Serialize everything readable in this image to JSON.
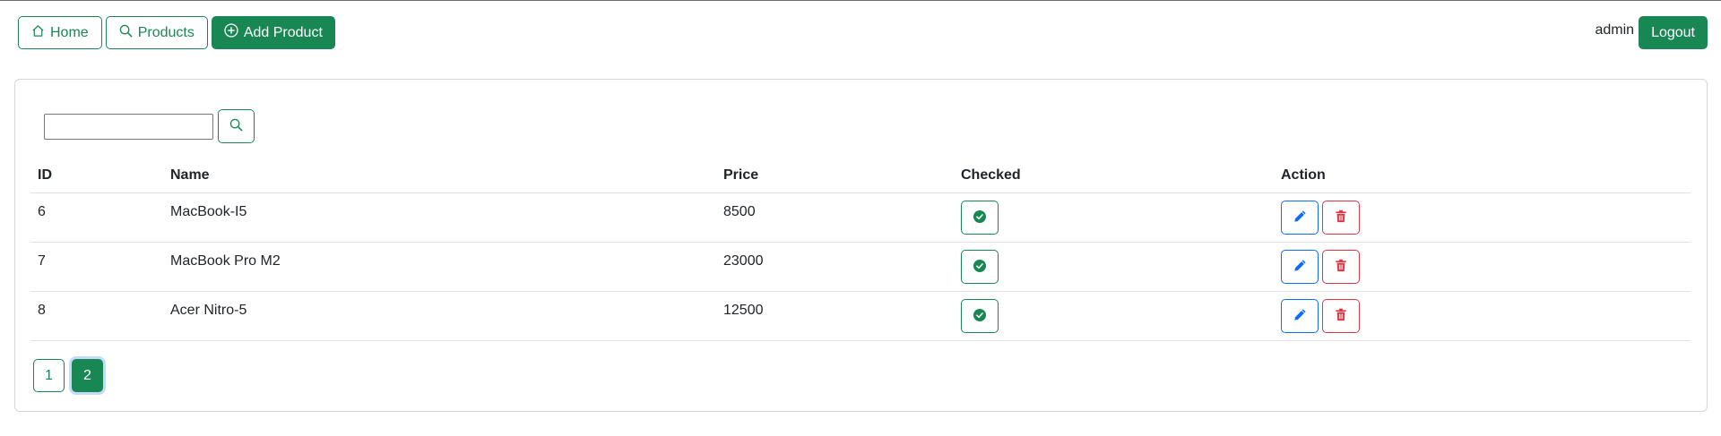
{
  "nav": {
    "home_label": "Home",
    "products_label": "Products",
    "add_product_label": "Add Product",
    "username": "admin",
    "logout_label": "Logout"
  },
  "search": {
    "value": "",
    "placeholder": ""
  },
  "table": {
    "headers": {
      "id": "ID",
      "name": "Name",
      "price": "Price",
      "checked": "Checked",
      "action": "Action"
    },
    "rows": [
      {
        "id": "6",
        "name": "MacBook-I5",
        "price": "8500",
        "checked": true
      },
      {
        "id": "7",
        "name": "MacBook Pro M2",
        "price": "23000",
        "checked": true
      },
      {
        "id": "8",
        "name": "Acer Nitro-5",
        "price": "12500",
        "checked": true
      }
    ]
  },
  "pagination": {
    "pages": [
      "1",
      "2"
    ],
    "current": "2"
  },
  "colors": {
    "primary_green": "#198754",
    "edit_blue": "#0d6efd",
    "delete_red": "#dc3545"
  }
}
